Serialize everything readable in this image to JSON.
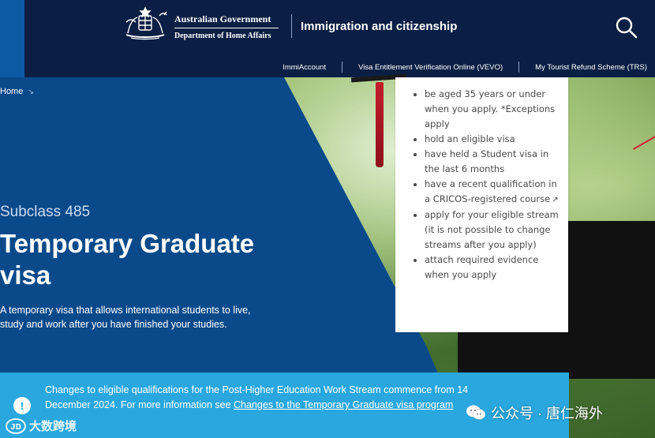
{
  "header": {
    "gov_line1": "Australian Government",
    "gov_line2": "Department of Home Affairs",
    "portal_title": "Immigration and citizenship",
    "search_icon": "search-icon"
  },
  "subnav": {
    "items": [
      "ImmiAccount",
      "Visa Entitlement Verification Online (VEVO)",
      "My Tourist Refund Scheme (TRS)"
    ]
  },
  "breadcrumb": {
    "home": "Home",
    "arrow": "↘"
  },
  "hero": {
    "subclass": "Subclass 485",
    "title": "Temporary Graduate visa",
    "description": "A temporary visa that allows international students to live, study and work after you have finished your studies."
  },
  "requirements": {
    "items": [
      "be aged 35 years or under when you apply. *Exceptions apply",
      "hold an eligible visa",
      "have held a Student visa in the last 6 months",
      "have a recent qualification in a CRICOS-registered course",
      "apply for your eligible stream (it is not possible to change streams after you apply)",
      "attach required evidence when you apply"
    ],
    "external_icon": "↗"
  },
  "notice": {
    "icon": "!",
    "text_before": "Changes to eligible qualifications for the Post-Higher Education Work Stream commence from 14 December 2024. For more information see ",
    "link": "Changes to the Temporary Graduate visa program"
  },
  "watermarks": {
    "left_logo": "ᴊᴅ",
    "left": "大数跨境",
    "right": "公众号 · 唐仁海外"
  },
  "colors": {
    "header_bg": "#0b1f44",
    "hero_blue": "#0b4a8a",
    "notice_bg": "#29a7de"
  }
}
